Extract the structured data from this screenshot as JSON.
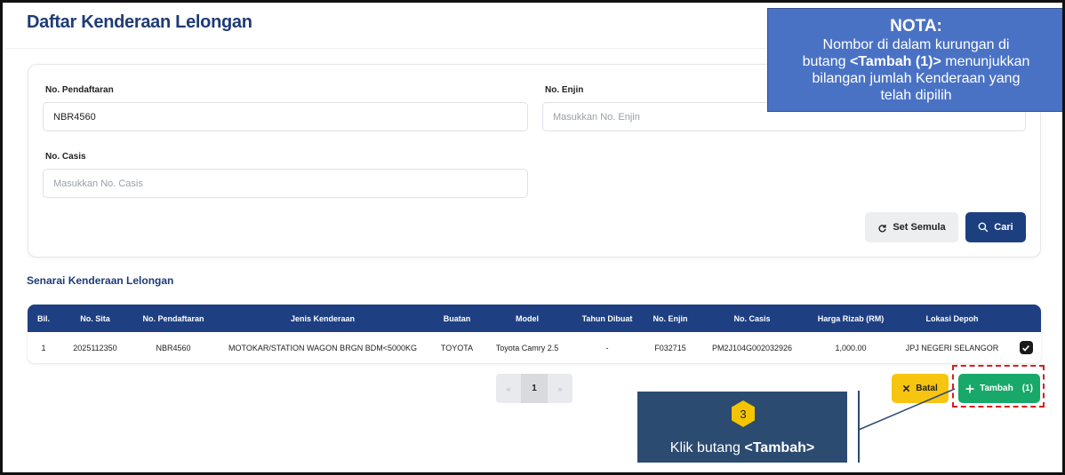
{
  "page": {
    "title": "Daftar Kenderaan Lelongan"
  },
  "search": {
    "plate_label": "No. Pendaftaran",
    "plate_value": "NBR4560",
    "engine_label": "No. Enjin",
    "engine_placeholder": "Masukkan No. Enjin",
    "chassis_label": "No. Casis",
    "chassis_placeholder": "Masukkan No. Casis",
    "reset_label": "Set Semula",
    "search_label": "Cari"
  },
  "list": {
    "title": "Senarai Kenderaan Lelongan",
    "columns": [
      "Bil.",
      "No. Sita",
      "No. Pendaftaran",
      "Jenis Kenderaan",
      "Buatan",
      "Model",
      "Tahun Dibuat",
      "No. Enjin",
      "No. Casis",
      "Harga Rizab (RM)",
      "Lokasi Depoh",
      ""
    ],
    "rows": [
      [
        "1",
        "2025112350",
        "NBR4560",
        "MOTOKAR/STATION WAGON BRGN BDM<5000KG",
        "TOYOTA",
        "Toyota Camry 2.5",
        "-",
        "F032715",
        "PM2J104G002032926",
        "1,000.00",
        "JPJ NEGERI SELANGOR"
      ]
    ]
  },
  "pagination": {
    "prev": "«",
    "current": "1",
    "next": "»"
  },
  "actions": {
    "cancel_label": "Batal",
    "add_label": "Tambah",
    "add_count": "(1)"
  },
  "callout": {
    "step_number": "3",
    "text_prefix": "Klik butang ",
    "text_bold": "<Tambah>"
  },
  "note": {
    "title": "NOTA:",
    "line1": "Nombor di dalam kurungan di",
    "line2_prefix": "butang ",
    "line2_bold": "<Tambah (1)>",
    "line2_suffix": " menunjukkan",
    "line3": "bilangan jumlah Kenderaan yang",
    "line4": "telah dipilih"
  },
  "colors": {
    "primary": "#1e3f82",
    "add_button": "#18a96a",
    "cancel_button": "#f7c510",
    "highlight": "#d61f1f",
    "note_background": "#4a72c4",
    "callout_background": "#2c4b70",
    "step_badge": "#f5c400"
  },
  "icons": {
    "reset": "refresh-icon",
    "search": "search-icon",
    "cancel": "close-icon",
    "add": "plus-icon",
    "row_check": "checkbox-checked-icon"
  }
}
